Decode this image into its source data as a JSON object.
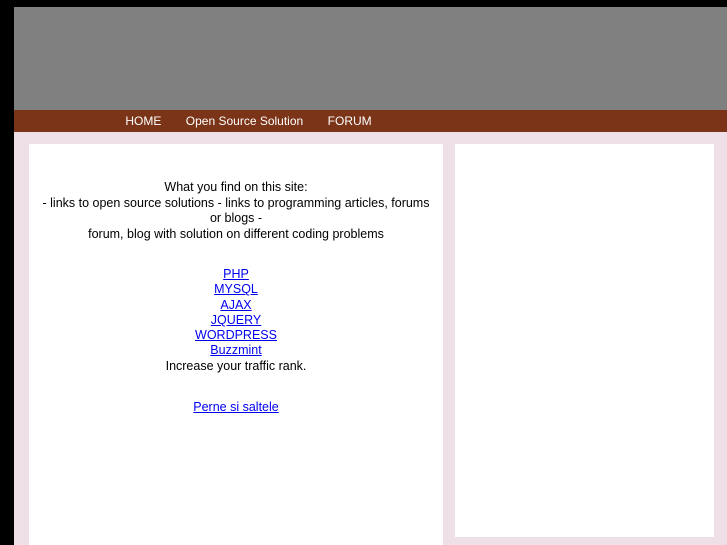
{
  "site": {
    "background_color": "#eee0e6",
    "frame_color": "#000000",
    "banner_color": "#808080",
    "nav_color": "#7b3418",
    "panel_color": "#ffffff",
    "link_color": "#0000ee"
  },
  "nav": {
    "items": [
      {
        "label": "HOME"
      },
      {
        "label": "Open Source Solution"
      },
      {
        "label": "FORUM"
      }
    ]
  },
  "main": {
    "intro": {
      "line1": "What you find on this site:",
      "line2": "- links to open source solutions - links to programming articles, forums or blogs -",
      "line3": "forum, blog with solution on different coding problems"
    },
    "links": [
      {
        "label": "PHP"
      },
      {
        "label": "MYSQL"
      },
      {
        "label": "AJAX"
      },
      {
        "label": "JQUERY"
      },
      {
        "label": "WORDPRESS"
      },
      {
        "label": "Buzzmint"
      }
    ],
    "tagline": "Increase your traffic rank.",
    "extra_links": [
      {
        "label": "Perne si saltele"
      }
    ]
  }
}
